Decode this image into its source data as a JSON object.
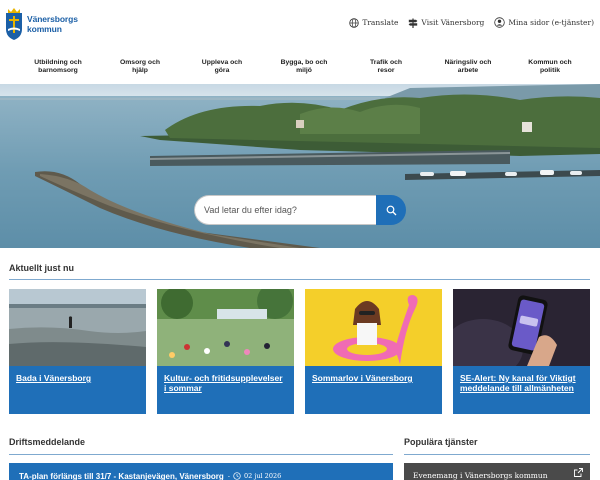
{
  "brand": {
    "line1": "Vänersborgs",
    "line2": "kommun",
    "color": "#1b5fa6"
  },
  "top_links": [
    {
      "label": "Translate",
      "icon": "globe-icon"
    },
    {
      "label": "Visit Vänersborg",
      "icon": "signpost-icon"
    },
    {
      "label": "Mina sidor (e-tjänster)",
      "icon": "user-icon"
    }
  ],
  "nav": [
    {
      "line1": "Utbildning och",
      "line2": "barnomsorg"
    },
    {
      "line1": "Omsorg och",
      "line2": "hjälp"
    },
    {
      "line1": "Uppleva och",
      "line2": "göra"
    },
    {
      "line1": "Bygga, bo och",
      "line2": "miljö"
    },
    {
      "line1": "Trafik och",
      "line2": "resor"
    },
    {
      "line1": "Näringsliv och",
      "line2": "arbete"
    },
    {
      "line1": "Kommun och",
      "line2": "politik"
    }
  ],
  "search": {
    "placeholder": "Vad letar du efter idag?"
  },
  "news": {
    "title": "Aktuellt just nu",
    "cards": [
      {
        "title": "Bada i Vänersborg"
      },
      {
        "title": "Kultur- och fritidsupplevelser i sommar"
      },
      {
        "title": "Sommarlov i Vänersborg"
      },
      {
        "title": "SE-Alert: Ny kanal för Viktigt meddelande till allmänheten"
      }
    ]
  },
  "drift": {
    "title": "Driftsmeddelande",
    "item_text": "TA-plan förlängs till 31/7 - Kastanjevägen, Vänersborg",
    "separator": "-",
    "date": "02 jul 2026"
  },
  "popular": {
    "title": "Populära tjänster",
    "item": "Evenemang i Vänersborgs kommun"
  },
  "colors": {
    "accent": "#1f6fb8",
    "rule": "#7fa9cf",
    "service_bg": "#4a4a4a"
  }
}
